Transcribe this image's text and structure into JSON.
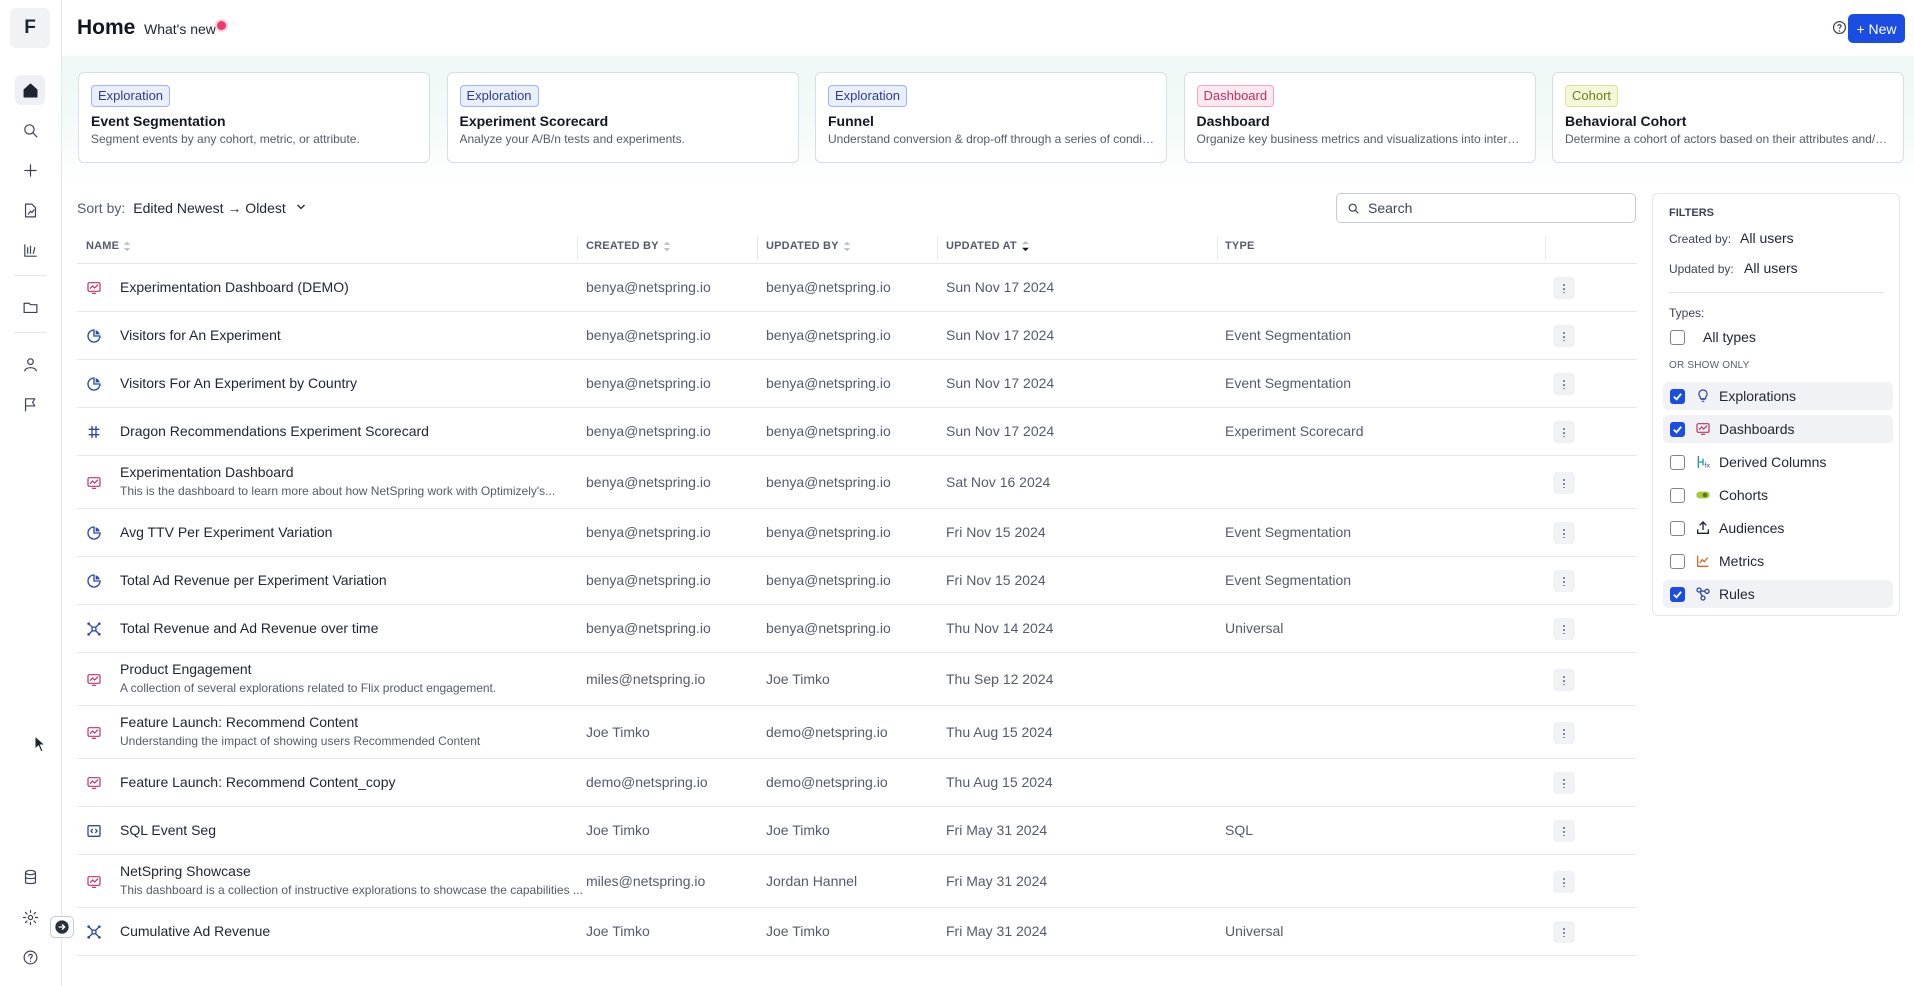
{
  "rail": {
    "logo": "F",
    "icons": [
      "home-icon",
      "search-icon",
      "plus-icon",
      "file-chart-icon",
      "library-icon",
      "folder-icon",
      "user-icon",
      "flag-icon",
      "database-icon",
      "gear-icon",
      "help-icon"
    ]
  },
  "header": {
    "title": "Home",
    "whats_new": "What's new",
    "new_button": "+ New"
  },
  "templates": [
    {
      "tag": "Exploration",
      "tag_kind": "explo",
      "title": "Event Segmentation",
      "desc": "Segment events by any cohort, metric, or attribute."
    },
    {
      "tag": "Exploration",
      "tag_kind": "explo",
      "title": "Experiment Scorecard",
      "desc": "Analyze your A/B/n tests and experiments."
    },
    {
      "tag": "Exploration",
      "tag_kind": "explo",
      "title": "Funnel",
      "desc": "Understand conversion & drop-off through a series of conditi..."
    },
    {
      "tag": "Dashboard",
      "tag_kind": "dash",
      "title": "Dashboard",
      "desc": "Organize key business metrics and visualizations into interacti..."
    },
    {
      "tag": "Cohort",
      "tag_kind": "cohort",
      "title": "Behavioral Cohort",
      "desc": "Determine a cohort of actors based on their attributes and/or ..."
    }
  ],
  "sort": {
    "label": "Sort by:",
    "value": "Edited Newest → Oldest"
  },
  "search": {
    "placeholder": "Search"
  },
  "table": {
    "columns": [
      "NAME",
      "CREATED BY",
      "UPDATED BY",
      "UPDATED AT",
      "TYPE"
    ],
    "rows": [
      {
        "icon": "dashboard",
        "name": "Experimentation Dashboard (DEMO)",
        "desc": "",
        "created_by": "benya@netspring.io",
        "updated_by": "benya@netspring.io",
        "updated_at": "Sun Nov 17 2024",
        "type": ""
      },
      {
        "icon": "segmentation",
        "name": "Visitors for An Experiment",
        "desc": "",
        "created_by": "benya@netspring.io",
        "updated_by": "benya@netspring.io",
        "updated_at": "Sun Nov 17 2024",
        "type": "Event Segmentation"
      },
      {
        "icon": "segmentation",
        "name": "Visitors For An Experiment by Country",
        "desc": "",
        "created_by": "benya@netspring.io",
        "updated_by": "benya@netspring.io",
        "updated_at": "Sun Nov 17 2024",
        "type": "Event Segmentation"
      },
      {
        "icon": "scorecard",
        "name": "Dragon Recommendations Experiment Scorecard",
        "desc": "",
        "created_by": "benya@netspring.io",
        "updated_by": "benya@netspring.io",
        "updated_at": "Sun Nov 17 2024",
        "type": "Experiment Scorecard"
      },
      {
        "icon": "dashboard",
        "name": "Experimentation Dashboard",
        "desc": "This is the dashboard to learn more about how NetSpring work with Optimizely's...",
        "created_by": "benya@netspring.io",
        "updated_by": "benya@netspring.io",
        "updated_at": "Sat Nov 16 2024",
        "type": ""
      },
      {
        "icon": "segmentation",
        "name": "Avg TTV Per Experiment Variation",
        "desc": "",
        "created_by": "benya@netspring.io",
        "updated_by": "benya@netspring.io",
        "updated_at": "Fri Nov 15 2024",
        "type": "Event Segmentation"
      },
      {
        "icon": "segmentation",
        "name": "Total Ad Revenue per Experiment Variation",
        "desc": "",
        "created_by": "benya@netspring.io",
        "updated_by": "benya@netspring.io",
        "updated_at": "Fri Nov 15 2024",
        "type": "Event Segmentation"
      },
      {
        "icon": "universal",
        "name": "Total Revenue and Ad Revenue over time",
        "desc": "",
        "created_by": "benya@netspring.io",
        "updated_by": "benya@netspring.io",
        "updated_at": "Thu Nov 14 2024",
        "type": "Universal"
      },
      {
        "icon": "dashboard",
        "name": "Product Engagement",
        "desc": "A collection of several explorations related to Flix product engagement.",
        "created_by": "miles@netspring.io",
        "updated_by": "Joe Timko",
        "updated_at": "Thu Sep 12 2024",
        "type": ""
      },
      {
        "icon": "dashboard",
        "name": "Feature Launch: Recommend Content",
        "desc": "Understanding the impact of showing users Recommended Content",
        "created_by": "Joe Timko",
        "updated_by": "demo@netspring.io",
        "updated_at": "Thu Aug 15 2024",
        "type": ""
      },
      {
        "icon": "dashboard",
        "name": "Feature Launch: Recommend Content_copy",
        "desc": "",
        "created_by": "demo@netspring.io",
        "updated_by": "demo@netspring.io",
        "updated_at": "Thu Aug 15 2024",
        "type": ""
      },
      {
        "icon": "sql",
        "name": "SQL Event Seg",
        "desc": "",
        "created_by": "Joe Timko",
        "updated_by": "Joe Timko",
        "updated_at": "Fri May 31 2024",
        "type": "SQL"
      },
      {
        "icon": "dashboard",
        "name": "NetSpring Showcase",
        "desc": "This dashboard is a collection of instructive explorations to showcase the capabilities ...",
        "created_by": "miles@netspring.io",
        "updated_by": "Jordan Hannel",
        "updated_at": "Fri May 31 2024",
        "type": ""
      },
      {
        "icon": "universal",
        "name": "Cumulative Ad Revenue",
        "desc": "",
        "created_by": "Joe Timko",
        "updated_by": "Joe Timko",
        "updated_at": "Fri May 31 2024",
        "type": "Universal"
      }
    ]
  },
  "filters": {
    "title": "FILTERS",
    "created_by_label": "Created by:",
    "created_by_value": "All users",
    "updated_by_label": "Updated by:",
    "updated_by_value": "All users",
    "types_label": "Types:",
    "all_types": "All types",
    "or_show_only": "OR SHOW ONLY",
    "options": [
      {
        "label": "Explorations",
        "checked": true,
        "icon": "bulb-icon"
      },
      {
        "label": "Dashboards",
        "checked": true,
        "icon": "dashboard-icon"
      },
      {
        "label": "Derived Columns",
        "checked": false,
        "icon": "derived-column-icon"
      },
      {
        "label": "Cohorts",
        "checked": false,
        "icon": "cohort-icon"
      },
      {
        "label": "Audiences",
        "checked": false,
        "icon": "upload-icon"
      },
      {
        "label": "Metrics",
        "checked": false,
        "icon": "metric-icon"
      },
      {
        "label": "Rules",
        "checked": true,
        "icon": "rules-icon"
      }
    ]
  },
  "colors": {
    "accent": "#1b4de3",
    "dashboard_icon": "#c2306a",
    "exploration_icon": "#2c47a8"
  }
}
